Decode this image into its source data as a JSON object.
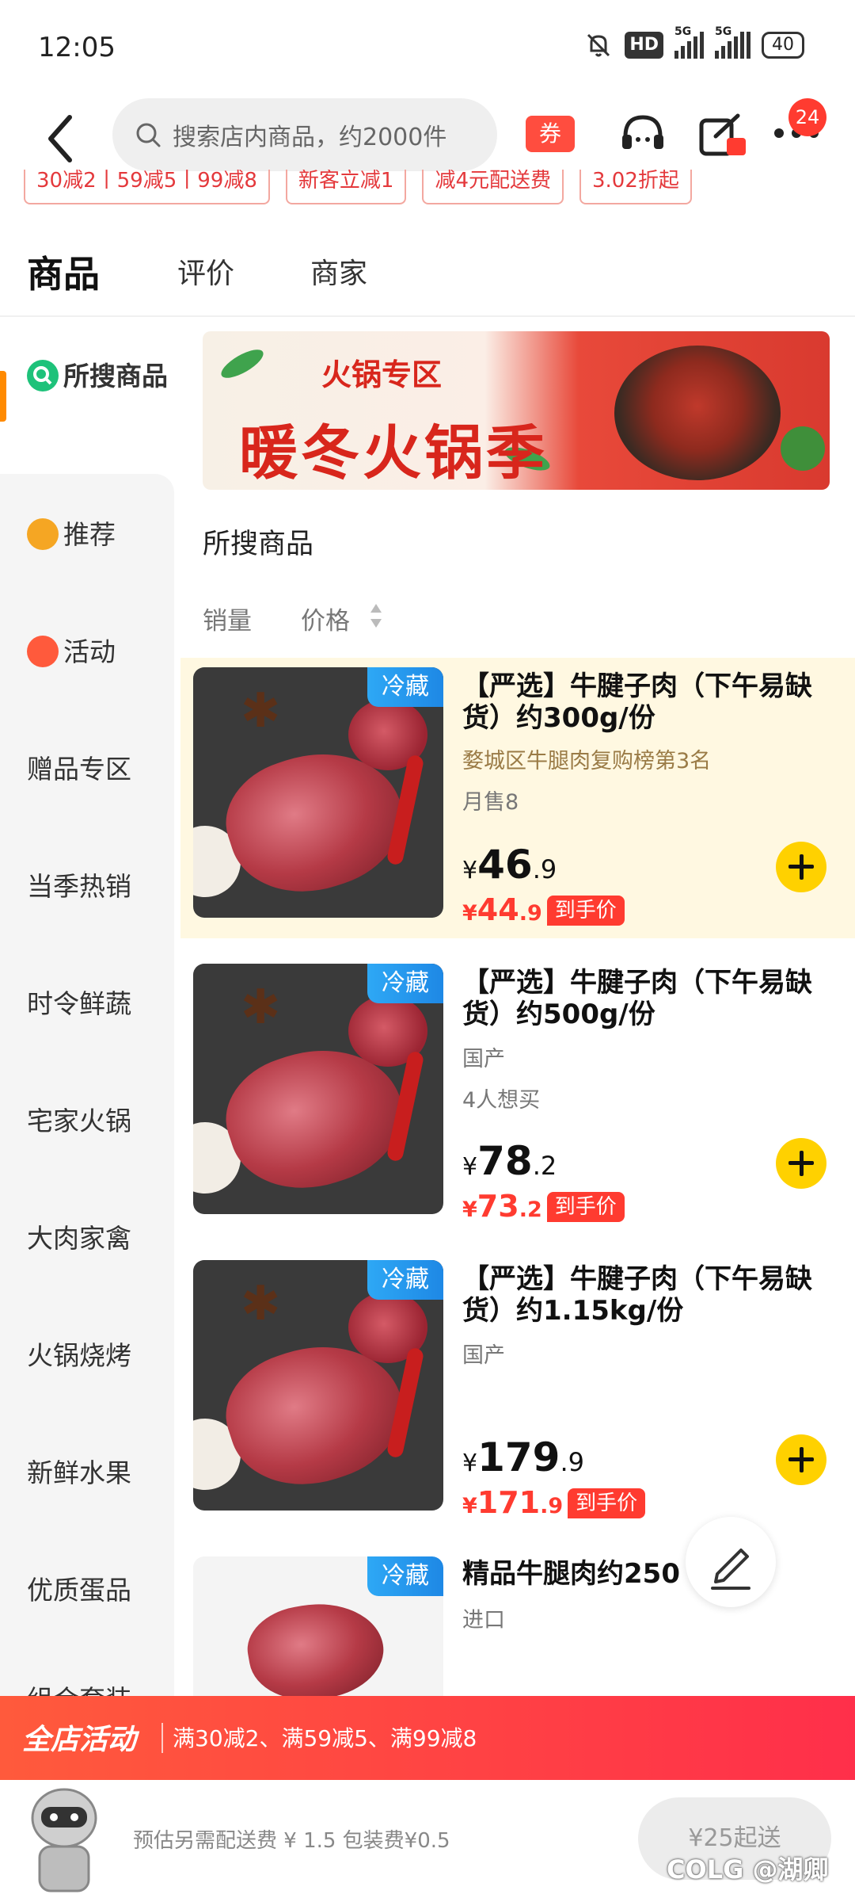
{
  "status_bar": {
    "time": "12:05",
    "hd": "HD",
    "net1": "5G",
    "net2": "5G",
    "battery": "40"
  },
  "header": {
    "search_placeholder": "搜索店内商品，约2000件",
    "coupon_label": "券",
    "cart_badge": "24"
  },
  "promo_tags": [
    "30减2丨59减5丨99减8",
    "新客立减1",
    "减4元配送费",
    "3.02折起"
  ],
  "tabs": [
    {
      "label": "商品",
      "active": true
    },
    {
      "label": "评价",
      "active": false
    },
    {
      "label": "商家",
      "active": false
    }
  ],
  "sidebar": {
    "items": [
      {
        "label": "所搜商品",
        "icon": "search-icon",
        "active": true
      },
      {
        "label": "推荐",
        "icon": "recommend-icon",
        "active": false
      },
      {
        "label": "活动",
        "icon": "activity-icon",
        "active": false
      },
      {
        "label": "赠品专区"
      },
      {
        "label": "当季热销"
      },
      {
        "label": "时令鲜蔬"
      },
      {
        "label": "宅家火锅"
      },
      {
        "label": "大肉家禽"
      },
      {
        "label": "火锅烧烤"
      },
      {
        "label": "新鲜水果"
      },
      {
        "label": "优质蛋品"
      },
      {
        "label": "组合套装"
      }
    ]
  },
  "banner": {
    "small_text": "火锅专区",
    "big_text": "暖冬火锅季"
  },
  "section": {
    "title": "所搜商品",
    "sort_sales": "销量",
    "sort_price": "价格"
  },
  "products": [
    {
      "tag": "冷藏",
      "title": "【严选】牛腱子肉（下午易缺货）约300g/份",
      "sub1": "婺城区牛腿肉复购榜第3名",
      "sub2": "月售8",
      "price_symbol": "¥",
      "price_int": "46",
      "price_dec": ".9",
      "deal_int": "44",
      "deal_dec": ".9",
      "deal_label": "到手价"
    },
    {
      "tag": "冷藏",
      "title": "【严选】牛腱子肉（下午易缺货）约500g/份",
      "sub1": "国产",
      "sub2": "4人想买",
      "price_symbol": "¥",
      "price_int": "78",
      "price_dec": ".2",
      "deal_int": "73",
      "deal_dec": ".2",
      "deal_label": "到手价"
    },
    {
      "tag": "冷藏",
      "title": "【严选】牛腱子肉（下午易缺货）约1.15kg/份",
      "sub1": "国产",
      "price_symbol": "¥",
      "price_int": "179",
      "price_dec": ".9",
      "deal_int": "171",
      "deal_dec": ".9",
      "deal_label": "到手价"
    },
    {
      "tag": "冷藏",
      "title": "精品牛腿肉约250",
      "sub1": "进口"
    }
  ],
  "activity_bar": {
    "label": "全店活动",
    "text": "满30减2、满59减5、满99减8"
  },
  "bottom_bar": {
    "fee_text": "预估另需配送费 ¥ 1.5  包装费¥0.5",
    "min_order": "¥25起送",
    "watermark": "COLG @湖卿"
  },
  "colors": {
    "accent": "#ffd100",
    "price_red": "#ff3b30",
    "cold_blue": "#1e88e5"
  }
}
